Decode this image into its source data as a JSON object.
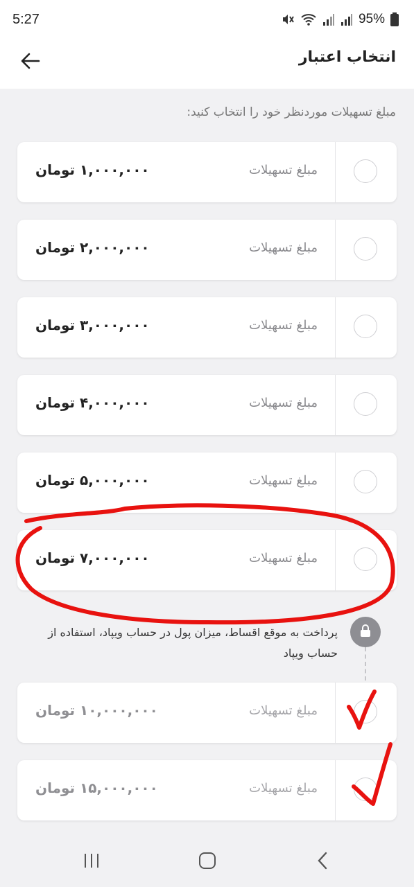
{
  "status_bar": {
    "time": "5:27",
    "battery": "95%",
    "icons": [
      "mute-icon",
      "wifi-icon",
      "signal-icon",
      "signal-icon",
      "battery-icon"
    ]
  },
  "header": {
    "title": "انتخاب اعتبار",
    "back_icon": "arrow-left-icon"
  },
  "instruction": "مبلغ تسهیلات موردنظر خود را انتخاب کنید:",
  "options": [
    {
      "label": "مبلغ تسهیلات",
      "amount": "۱,۰۰۰,۰۰۰ تومان",
      "locked": false
    },
    {
      "label": "مبلغ تسهیلات",
      "amount": "۲,۰۰۰,۰۰۰ تومان",
      "locked": false
    },
    {
      "label": "مبلغ تسهیلات",
      "amount": "۳,۰۰۰,۰۰۰ تومان",
      "locked": false
    },
    {
      "label": "مبلغ تسهیلات",
      "amount": "۴,۰۰۰,۰۰۰ تومان",
      "locked": false
    },
    {
      "label": "مبلغ تسهیلات",
      "amount": "۵,۰۰۰,۰۰۰ تومان",
      "locked": false
    },
    {
      "label": "مبلغ تسهیلات",
      "amount": "۷,۰۰۰,۰۰۰ تومان",
      "locked": false
    },
    {
      "label": "مبلغ تسهیلات",
      "amount": "۱۰,۰۰۰,۰۰۰ تومان",
      "locked": true
    },
    {
      "label": "مبلغ تسهیلات",
      "amount": "۱۵,۰۰۰,۰۰۰ تومان",
      "locked": true
    }
  ],
  "lock_note": "پرداخت به موقع اقساط، میزان پول در حساب ویپاد، استفاده از حساب ویپاد",
  "nav": [
    "recent-apps-icon",
    "home-icon",
    "back-icon"
  ],
  "colors": {
    "background": "#f1f1f3",
    "card": "#ffffff",
    "annotation": "#e8120f",
    "lock_badge": "#8e8e93"
  }
}
